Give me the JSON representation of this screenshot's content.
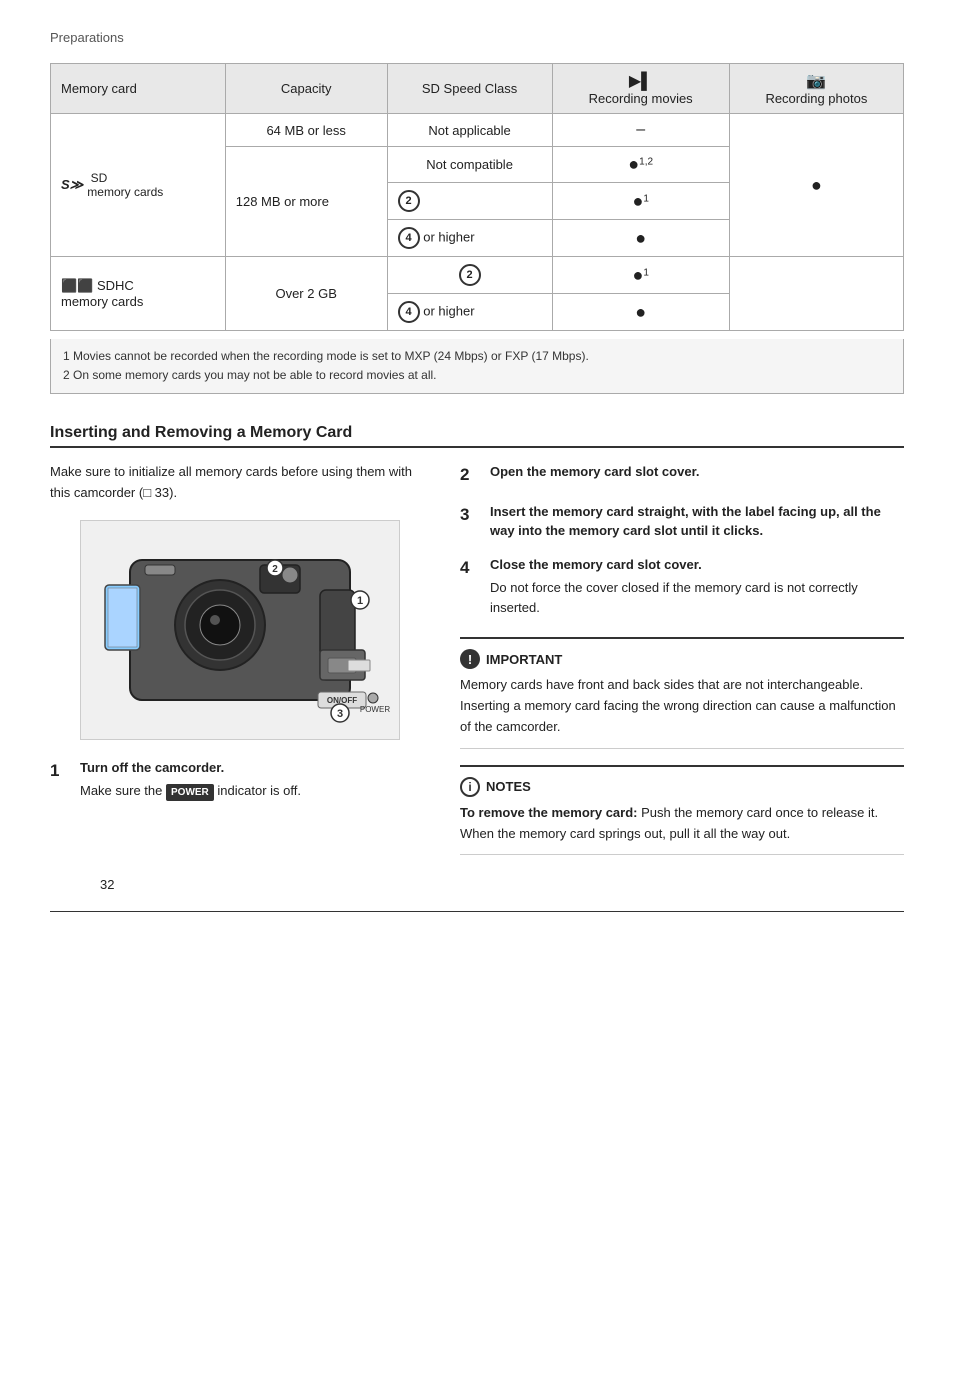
{
  "page": {
    "breadcrumb": "Preparations",
    "page_number": "32"
  },
  "table": {
    "headers": [
      "Memory card",
      "Capacity",
      "SD Speed Class",
      "Recording movies",
      "Recording photos"
    ],
    "rows": [
      {
        "card_type": "SD memory cards",
        "capacity": "64 MB or less",
        "speed_class": "Not applicable",
        "recording_movies": "–",
        "recording_photos": ""
      },
      {
        "card_type": "",
        "capacity": "128 MB or more",
        "speed_class": "Not compatible",
        "recording_movies": "●1,2",
        "recording_photos": ""
      },
      {
        "card_type": "",
        "capacity": "",
        "speed_class": "CLASS2",
        "recording_movies": "●1",
        "recording_photos": "●"
      },
      {
        "card_type": "",
        "capacity": "",
        "speed_class": "CLASS4 or higher",
        "recording_movies": "●",
        "recording_photos": ""
      },
      {
        "card_type": "SDHC memory cards",
        "capacity": "Over 2 GB",
        "speed_class": "CLASS2",
        "recording_movies": "●1",
        "recording_photos": ""
      },
      {
        "card_type": "",
        "capacity": "",
        "speed_class": "CLASS4 or higher",
        "recording_movies": "●",
        "recording_photos": ""
      }
    ],
    "footnotes": [
      "1  Movies cannot be recorded when the recording mode is set to MXP (24 Mbps) or FXP (17 Mbps).",
      "2  On some memory cards you may not be able to record movies at all."
    ]
  },
  "section": {
    "title": "Inserting and Removing a Memory Card",
    "intro": "Make sure to initialize all memory cards before using them with this camcorder (□ 33).",
    "steps": [
      {
        "num": "1",
        "heading": "Turn off the camcorder.",
        "body": "Make sure the POWER indicator is off."
      },
      {
        "num": "2",
        "heading": "Open the memory card slot cover.",
        "body": ""
      },
      {
        "num": "3",
        "heading": "Insert the memory card straight, with the label facing up, all the way into the memory card slot until it clicks.",
        "body": ""
      },
      {
        "num": "4",
        "heading": "Close the memory card slot cover.",
        "body": "Do not force the cover closed if the memory card is not correctly inserted."
      }
    ]
  },
  "important": {
    "title": "IMPORTANT",
    "text": "Memory cards have front and back sides that are not interchangeable. Inserting a memory card facing the wrong direction can cause a malfunction of the camcorder."
  },
  "notes": {
    "title": "NOTES",
    "text_bold": "To remove the memory card:",
    "text": " Push the memory card once to release it. When the memory card springs out, pull it all the way out."
  }
}
